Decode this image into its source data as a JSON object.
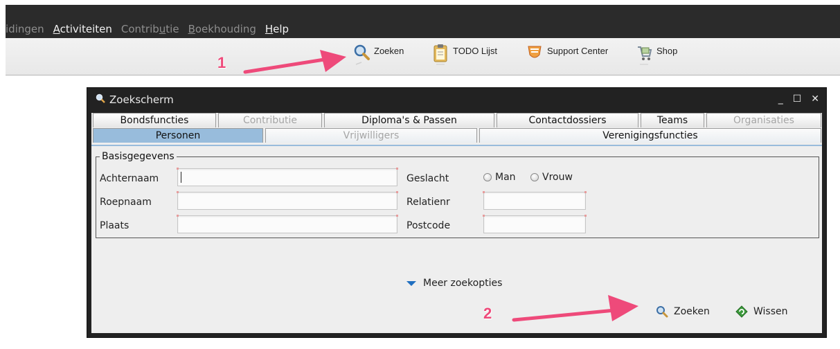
{
  "menubar": {
    "items": [
      {
        "pre": "idingen",
        "u": "",
        "post": "",
        "active": false
      },
      {
        "pre": "",
        "u": "A",
        "post": "ctiviteiten",
        "active": true
      },
      {
        "pre": "Contrib",
        "u": "u",
        "post": "tie",
        "active": false
      },
      {
        "pre": "",
        "u": "B",
        "post": "oekhouding",
        "active": false
      },
      {
        "pre": "",
        "u": "H",
        "post": "elp",
        "active": true
      }
    ]
  },
  "toolbar": {
    "zoeken": "Zoeken",
    "todo": "TODO Lijst",
    "support": "Support Center",
    "shop": "Shop"
  },
  "annotations": {
    "one": "1",
    "two": "2"
  },
  "window": {
    "title": "Zoekscherm",
    "controls": [
      "_",
      "☐",
      "✕"
    ]
  },
  "tabs_row1": [
    {
      "label": "Bondsfuncties",
      "enabled": true
    },
    {
      "label": "Contributie",
      "enabled": false
    },
    {
      "label": "Diploma's & Passen",
      "enabled": true
    },
    {
      "label": "Contactdossiers",
      "enabled": true
    },
    {
      "label": "Teams",
      "enabled": true
    },
    {
      "label": "Organisaties",
      "enabled": false
    }
  ],
  "tabs_row2": [
    {
      "label": "Personen",
      "enabled": true,
      "selected": true
    },
    {
      "label": "Vrijwilligers",
      "enabled": false,
      "selected": false
    },
    {
      "label": "Verenigingsfuncties",
      "enabled": true,
      "selected": false
    }
  ],
  "basis": {
    "legend": "Basisgegevens",
    "achternaam": "Achternaam",
    "roepnaam": "Roepnaam",
    "plaats": "Plaats",
    "geslacht": "Geslacht",
    "relatienr": "Relatienr",
    "postcode": "Postcode",
    "man": "Man",
    "vrouw": "Vrouw",
    "values": {
      "achternaam": "",
      "roepnaam": "",
      "plaats": "",
      "relatienr": "",
      "postcode": ""
    }
  },
  "more_options": "Meer zoekopties",
  "actions": {
    "zoeken": "Zoeken",
    "wissen": "Wissen"
  }
}
